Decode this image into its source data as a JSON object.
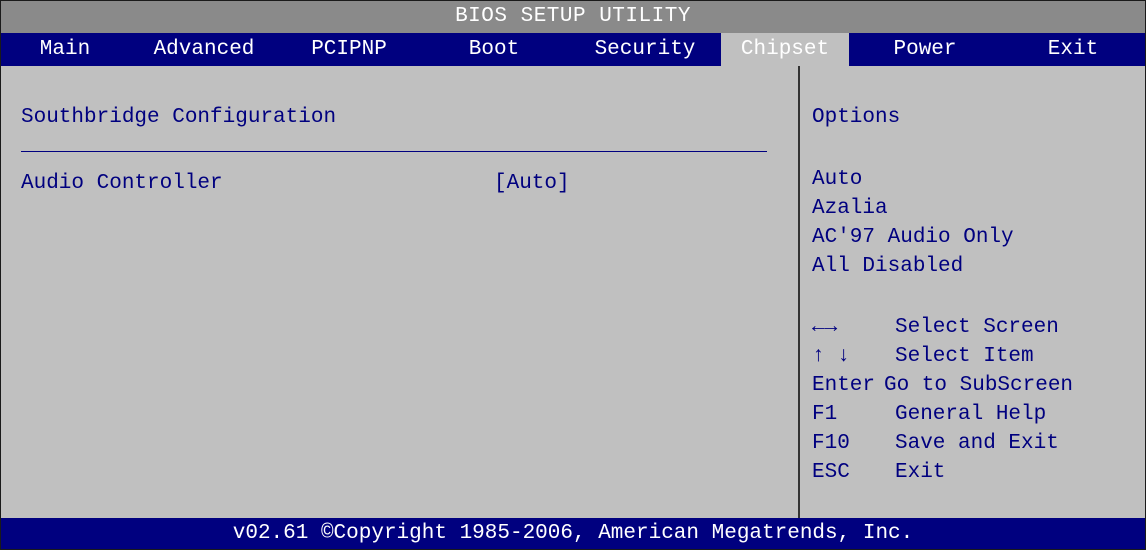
{
  "title": "BIOS SETUP UTILITY",
  "tabs": [
    "Main",
    "Advanced",
    "PCIPNP",
    "Boot",
    "Security",
    "Chipset",
    "Power",
    "Exit"
  ],
  "active_tab": "Chipset",
  "section_title": "Southbridge Configuration",
  "setting": {
    "label": "Audio Controller",
    "value": "[Auto]"
  },
  "help": {
    "title": "Options",
    "options": [
      "Auto",
      "Azalia",
      "AC'97 Audio Only",
      "All Disabled"
    ],
    "keys": [
      {
        "key": "←→",
        "desc": "Select Screen"
      },
      {
        "key": "↑ ↓",
        "desc": "Select Item"
      },
      {
        "key": "Enter",
        "desc": "Go to SubScreen"
      },
      {
        "key": "F1",
        "desc": "General Help"
      },
      {
        "key": "F10",
        "desc": "Save and Exit"
      },
      {
        "key": "ESC",
        "desc": "Exit"
      }
    ]
  },
  "footer": "v02.61 ©Copyright 1985-2006, American Megatrends, Inc.",
  "colors": {
    "background": "#c0c0c0",
    "title_bar": "#8a8a8a",
    "menu_bar": "#00007f",
    "text_blue": "#00007f",
    "text_white": "#ffffff"
  }
}
